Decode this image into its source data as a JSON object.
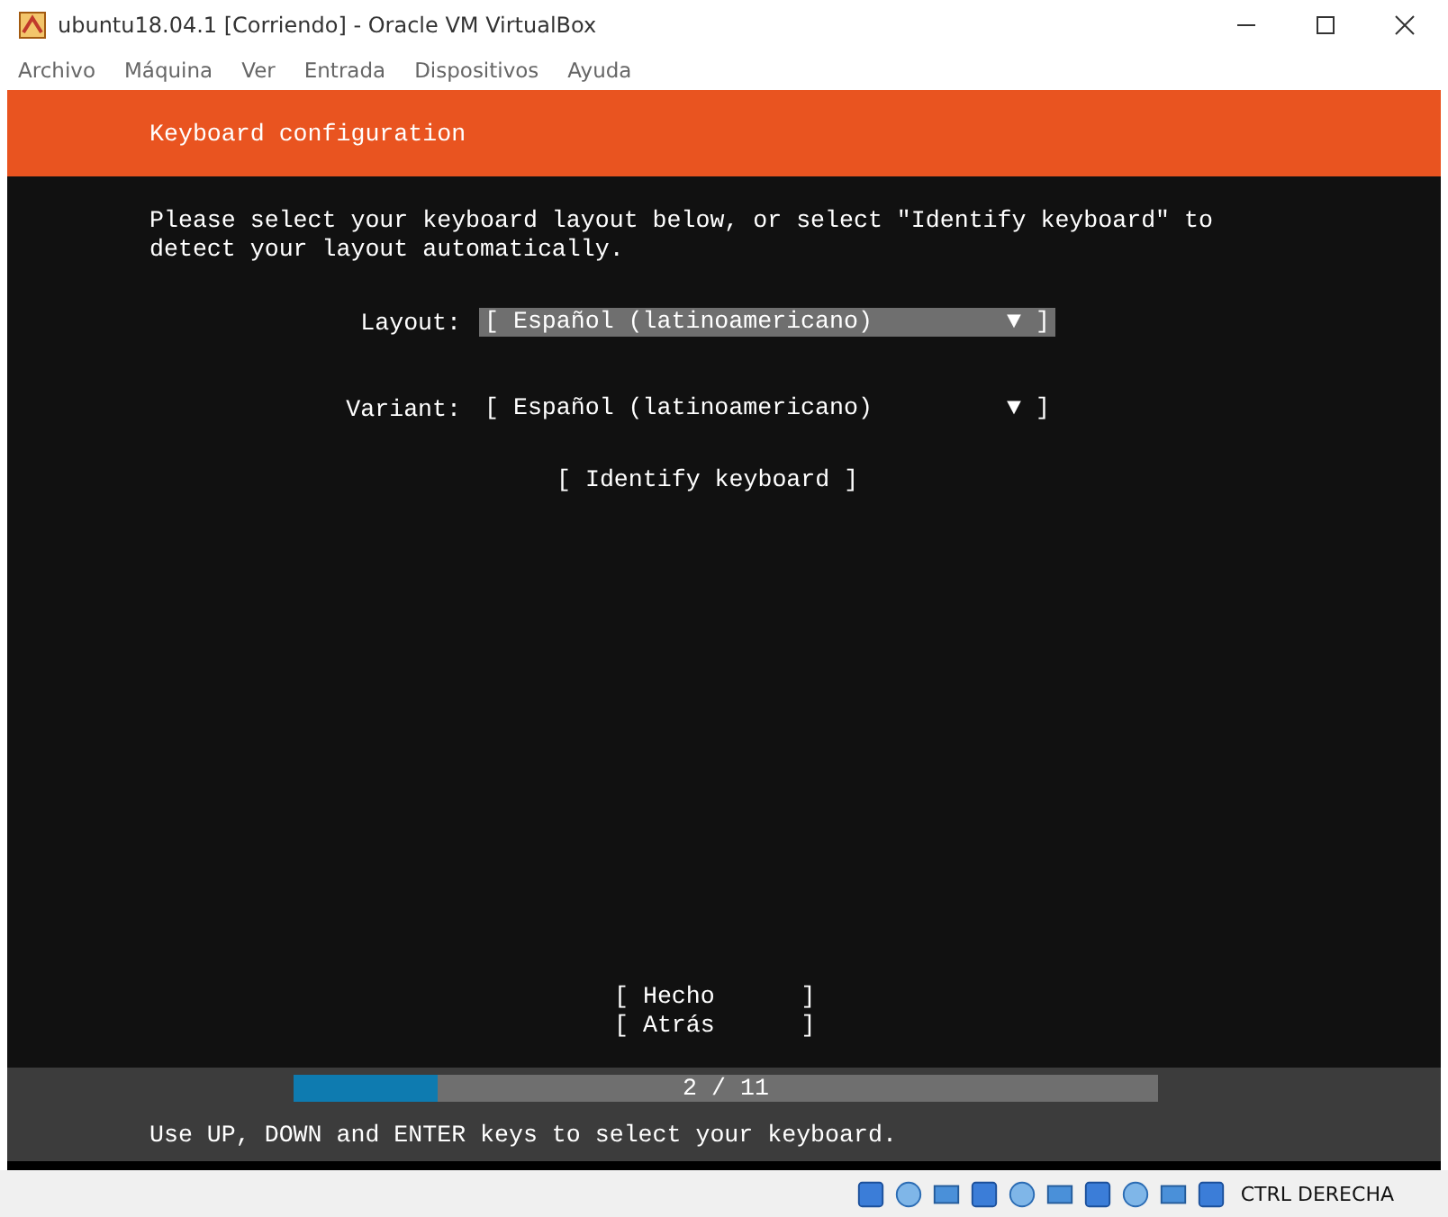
{
  "window": {
    "title": "ubuntu18.04.1 [Corriendo] - Oracle VM VirtualBox"
  },
  "menu": [
    "Archivo",
    "Máquina",
    "Ver",
    "Entrada",
    "Dispositivos",
    "Ayuda"
  ],
  "header": {
    "title": "Keyboard configuration"
  },
  "intro": "Please select your keyboard layout below, or select \"Identify keyboard\" to\ndetect your layout automatically.",
  "dropdowns": [
    {
      "label": "Layout:",
      "value": "[ Español (latinoamericano)",
      "arrow": "▼ ]",
      "focused": true
    },
    {
      "label": "Variant:",
      "value": "[ Español (latinoamericano)",
      "arrow": "▼ ]",
      "focused": false
    }
  ],
  "identify_button": "[ Identify keyboard ]",
  "buttons": [
    "[ Hecho      ]",
    "[ Atrás      ]"
  ],
  "progress": {
    "level": 0.167,
    "text": "2 / 11"
  },
  "hint": "Use UP, DOWN and ENTER keys to select your keyboard.",
  "status_bar": {
    "host_key": "CTRL DERECHA"
  }
}
